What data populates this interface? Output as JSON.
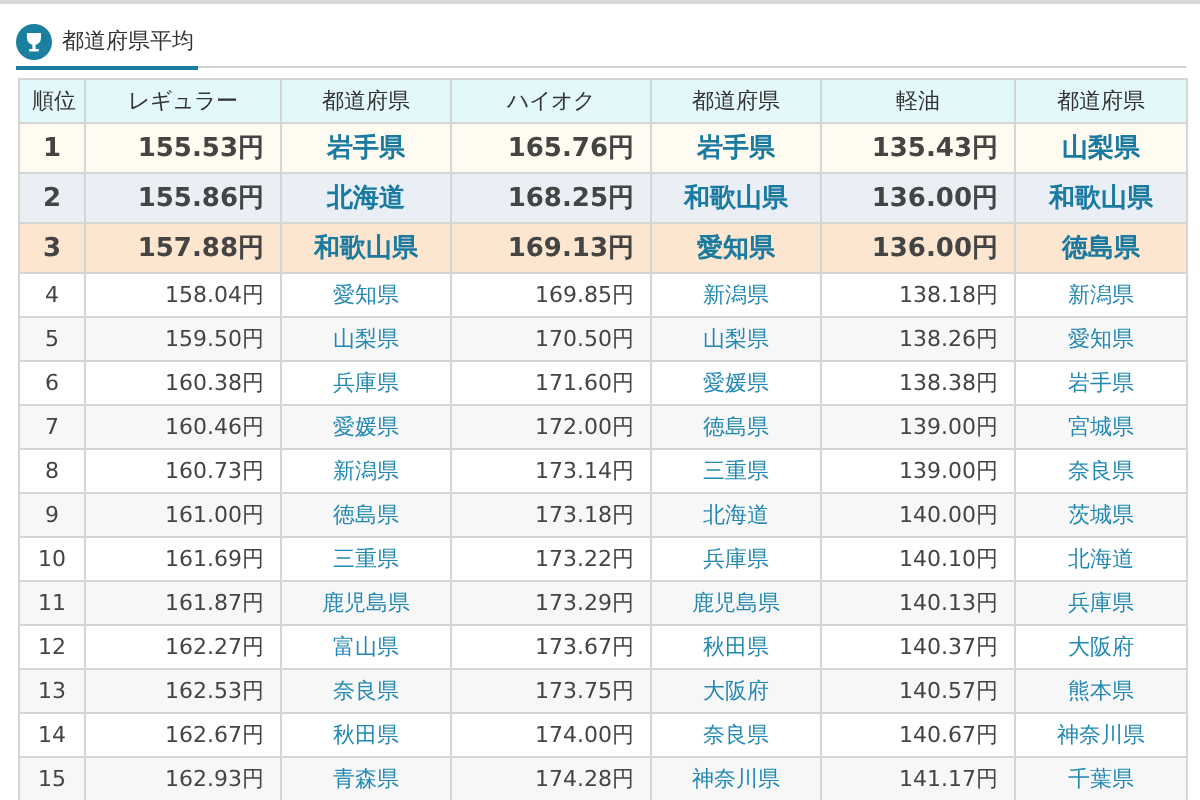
{
  "panel": {
    "title": "都道府県平均"
  },
  "table": {
    "columns": [
      "順位",
      "レギュラー",
      "都道府県",
      "ハイオク",
      "都道府県",
      "軽油",
      "都道府県"
    ],
    "rows": [
      {
        "kind": "top",
        "color": "#fffbf0",
        "cells": [
          "1",
          "155.53円",
          "岩手県",
          "165.76円",
          "岩手県",
          "135.43円",
          "山梨県"
        ]
      },
      {
        "kind": "top",
        "color": "#e9eff5",
        "cells": [
          "2",
          "155.86円",
          "北海道",
          "168.25円",
          "和歌山県",
          "136.00円",
          "和歌山県"
        ]
      },
      {
        "kind": "top",
        "color": "#fde6cf",
        "cells": [
          "3",
          "157.88円",
          "和歌山県",
          "169.13円",
          "愛知県",
          "136.00円",
          "徳島県"
        ]
      },
      {
        "kind": "normal",
        "cells": [
          "4",
          "158.04円",
          "愛知県",
          "169.85円",
          "新潟県",
          "138.18円",
          "新潟県"
        ]
      },
      {
        "kind": "normal",
        "cells": [
          "5",
          "159.50円",
          "山梨県",
          "170.50円",
          "山梨県",
          "138.26円",
          "愛知県"
        ]
      },
      {
        "kind": "normal",
        "cells": [
          "6",
          "160.38円",
          "兵庫県",
          "171.60円",
          "愛媛県",
          "138.38円",
          "岩手県"
        ]
      },
      {
        "kind": "normal",
        "cells": [
          "7",
          "160.46円",
          "愛媛県",
          "172.00円",
          "徳島県",
          "139.00円",
          "宮城県"
        ]
      },
      {
        "kind": "normal",
        "cells": [
          "8",
          "160.73円",
          "新潟県",
          "173.14円",
          "三重県",
          "139.00円",
          "奈良県"
        ]
      },
      {
        "kind": "normal",
        "cells": [
          "9",
          "161.00円",
          "徳島県",
          "173.18円",
          "北海道",
          "140.00円",
          "茨城県"
        ]
      },
      {
        "kind": "normal",
        "cells": [
          "10",
          "161.69円",
          "三重県",
          "173.22円",
          "兵庫県",
          "140.10円",
          "北海道"
        ]
      },
      {
        "kind": "normal",
        "cells": [
          "11",
          "161.87円",
          "鹿児島県",
          "173.29円",
          "鹿児島県",
          "140.13円",
          "兵庫県"
        ]
      },
      {
        "kind": "normal",
        "cells": [
          "12",
          "162.27円",
          "富山県",
          "173.67円",
          "秋田県",
          "140.37円",
          "大阪府"
        ]
      },
      {
        "kind": "normal",
        "cells": [
          "13",
          "162.53円",
          "奈良県",
          "173.75円",
          "大阪府",
          "140.57円",
          "熊本県"
        ]
      },
      {
        "kind": "normal",
        "cells": [
          "14",
          "162.67円",
          "秋田県",
          "174.00円",
          "奈良県",
          "140.67円",
          "神奈川県"
        ]
      },
      {
        "kind": "normal",
        "cells": [
          "15",
          "162.93円",
          "青森県",
          "174.28円",
          "神奈川県",
          "141.17円",
          "千葉県"
        ]
      }
    ]
  }
}
